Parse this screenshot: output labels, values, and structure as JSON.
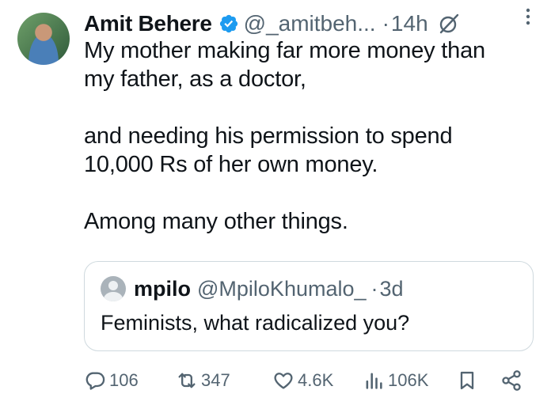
{
  "tweet": {
    "author_name": "Amit Behere",
    "handle": "@_amitbeh...",
    "separator": "·",
    "time": "14h",
    "body": "My mother making far more money than\nmy father, as a doctor,\n\nand needing his permission to spend\n10,000 Rs of her own money.\n\nAmong many other things."
  },
  "quoted": {
    "author_name": "mpilo",
    "handle": "@MpiloKhumalo_",
    "separator": "·",
    "time": "3d",
    "text": "Feminists, what radicalized you?"
  },
  "actions": {
    "replies": "106",
    "reposts": "347",
    "likes": "4.6K",
    "views": "106K"
  },
  "colors": {
    "verified": "#1d9bf0",
    "muted": "#536471",
    "text": "#0f1419",
    "border": "#cfd9de"
  },
  "icons": [
    "verified-badge-icon",
    "grok-icon",
    "more-icon",
    "reply-icon",
    "repost-icon",
    "like-icon",
    "views-icon",
    "bookmark-icon",
    "share-icon"
  ]
}
